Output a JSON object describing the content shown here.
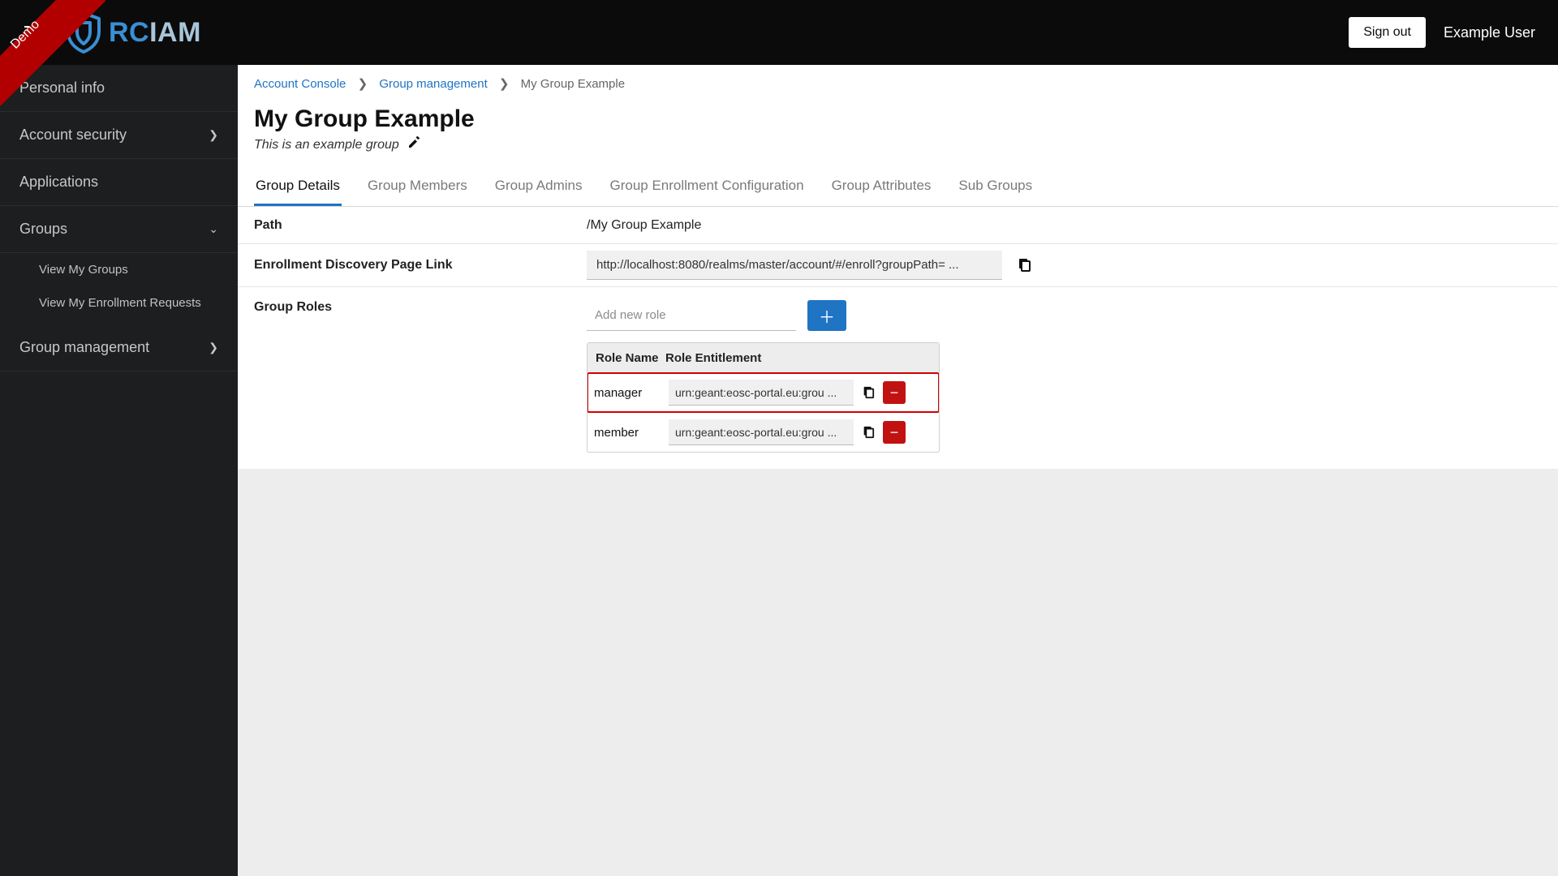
{
  "ribbon": {
    "label": "Demo"
  },
  "brand": {
    "rc": "RC",
    "iam": "IAM"
  },
  "header": {
    "sign_out": "Sign out",
    "user": "Example User"
  },
  "sidebar": {
    "personal_info": "Personal info",
    "account_security": "Account security",
    "applications": "Applications",
    "groups": "Groups",
    "view_my_groups": "View My Groups",
    "view_enrollment": "View My Enrollment Requests",
    "group_management": "Group management"
  },
  "breadcrumb": {
    "account_console": "Account Console",
    "group_management": "Group management",
    "current": "My Group Example"
  },
  "page": {
    "title": "My Group Example",
    "description": "This is an example group"
  },
  "tabs": {
    "details": "Group Details",
    "members": "Group Members",
    "admins": "Group Admins",
    "enrollment": "Group Enrollment Configuration",
    "attributes": "Group Attributes",
    "subgroups": "Sub Groups"
  },
  "details": {
    "path_label": "Path",
    "path_value": "/My Group Example",
    "enroll_label": "Enrollment Discovery Page Link",
    "enroll_url": "http://localhost:8080/realms/master/account/#/enroll?groupPath= ...",
    "roles_label": "Group Roles",
    "add_role_placeholder": "Add new role",
    "table": {
      "col_name": "Role Name",
      "col_entitlement": "Role Entitlement"
    },
    "roles": [
      {
        "name": "manager",
        "entitlement": "urn:geant:eosc-portal.eu:grou ...",
        "highlighted": true
      },
      {
        "name": "member",
        "entitlement": "urn:geant:eosc-portal.eu:grou ...",
        "highlighted": false
      }
    ]
  }
}
